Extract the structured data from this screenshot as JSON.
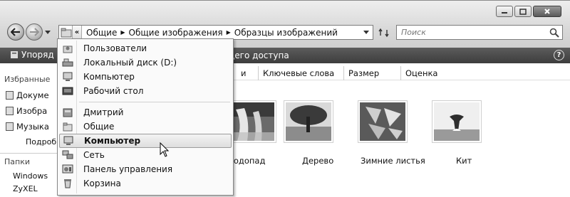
{
  "window": {
    "controls": [
      "minimize-icon",
      "maximize-icon",
      "close-icon"
    ]
  },
  "addressbar": {
    "breadcrumb": [
      "Общие",
      "Общие изображения",
      "Образцы изображений"
    ],
    "chevron": "«"
  },
  "search": {
    "placeholder": "Поиск"
  },
  "toolbar": {
    "organize_label": "Упоряд",
    "share_label": "щего доступа",
    "help_label": "?"
  },
  "sidebar": {
    "favorites_header": "Избранные",
    "favorites": [
      "Докуме",
      "Изобра",
      "Музыка"
    ],
    "more": "Подроб",
    "folders_header": "Папки",
    "tree": [
      "Windows",
      "ZyXEL"
    ]
  },
  "columns": [
    "и",
    "Ключевые слова",
    "Размер",
    "Оценка"
  ],
  "thumbnails": [
    {
      "caption": "Водопад",
      "icon": "waterfall-image"
    },
    {
      "caption": "Дерево",
      "icon": "tree-image"
    },
    {
      "caption": "Зимние листья",
      "icon": "leaves-image"
    },
    {
      "caption": "Кит",
      "icon": "whale-image"
    }
  ],
  "dropdown": {
    "items": [
      {
        "label": "Пользователи",
        "icon": "user-folder-icon"
      },
      {
        "label": "Локальный диск (D:)",
        "icon": "drive-icon"
      },
      {
        "label": "Компьютер",
        "icon": "computer-icon"
      },
      {
        "label": "Рабочий стол",
        "icon": "desktop-icon"
      },
      {
        "label": "Дмитрий",
        "icon": "user-folder-icon"
      },
      {
        "label": "Общие",
        "icon": "folder-icon"
      },
      {
        "label": "Компьютер",
        "icon": "computer-icon",
        "highlighted": true
      },
      {
        "label": "Сеть",
        "icon": "network-icon"
      },
      {
        "label": "Панель управления",
        "icon": "control-panel-icon"
      },
      {
        "label": "Корзина",
        "icon": "recycle-bin-icon"
      }
    ]
  }
}
